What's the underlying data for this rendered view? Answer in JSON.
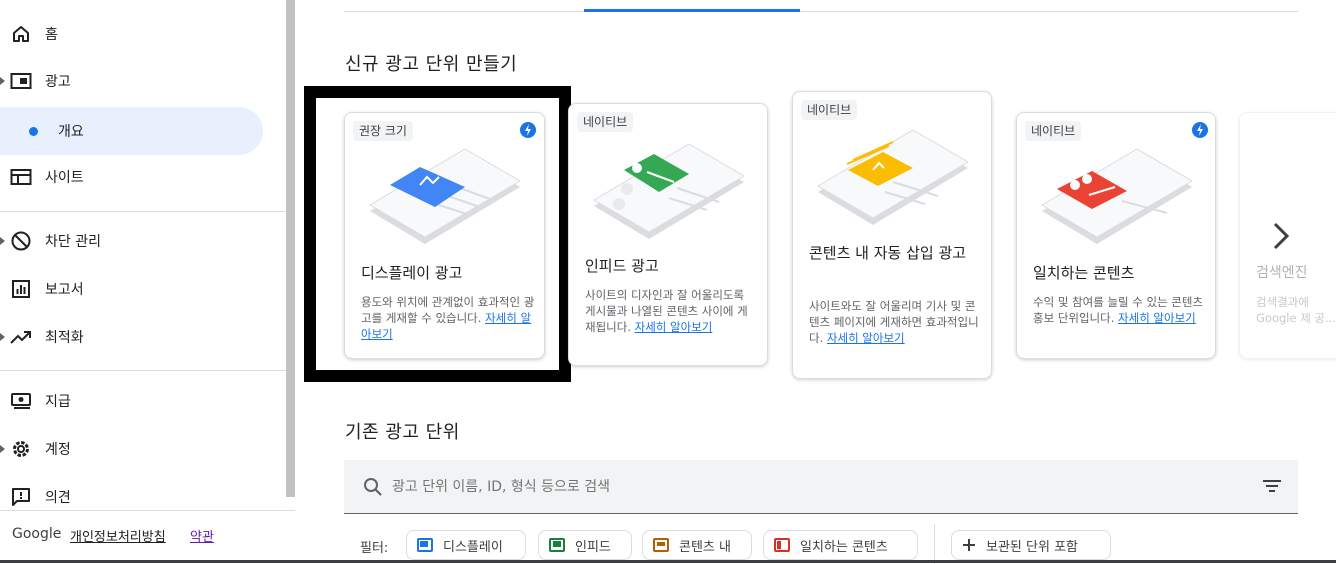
{
  "sidebar": {
    "items": [
      {
        "label": "홈"
      },
      {
        "label": "광고"
      },
      {
        "label": "개요"
      },
      {
        "label": "사이트"
      },
      {
        "label": "차단 관리"
      },
      {
        "label": "보고서"
      },
      {
        "label": "최적화"
      },
      {
        "label": "지급"
      },
      {
        "label": "계정"
      },
      {
        "label": "의견"
      }
    ],
    "footer": {
      "brand": "Google",
      "privacy": "개인정보처리방침",
      "terms": "약관"
    }
  },
  "main": {
    "create_title": "신규 광고 단위 만들기",
    "existing_title": "기존 광고 단위",
    "cards": [
      {
        "tag": "권장 크기",
        "title": "디스플레이 광고",
        "desc": "용도와 위치에 관계없이 효과적인 광고를 게재할 수 있습니다.",
        "link": "자세히 알아보기"
      },
      {
        "tag": "네이티브",
        "title": "인피드 광고",
        "desc": "사이트의 디자인과 잘 어울리도록 게시물과 나열된 콘텐츠 사이에 게재됩니다.",
        "link": "자세히 알아보기"
      },
      {
        "tag": "네이티브",
        "title": "콘텐츠 내 자동 삽입 광고",
        "desc": "사이트와도 잘 어울리며 기사 및 콘텐츠 페이지에 게재하면 효과적입니다.",
        "link": "자세히 알아보기"
      },
      {
        "tag": "네이티브",
        "title": "일치하는 콘텐츠",
        "desc": "수익 및 참여를 늘릴 수 있는 콘텐츠 홍보 단위입니다.",
        "link": "자세히 알아보기"
      },
      {
        "title": "검색엔진",
        "desc": "검색결과에 Google 제 공..."
      }
    ],
    "search": {
      "placeholder": "광고 단위 이름, ID, 형식 등으로 검색"
    },
    "filters": {
      "label": "필터:",
      "chips": [
        "디스플레이",
        "인피드",
        "콘텐츠 내",
        "일치하는 콘텐츠"
      ],
      "archived": "보관된 단위 포함"
    }
  },
  "colors": {
    "accent": "#1a73e8",
    "display": "#4285f4",
    "infeed": "#34a853",
    "inarticle": "#fbbc04",
    "matched": "#ea4335"
  }
}
